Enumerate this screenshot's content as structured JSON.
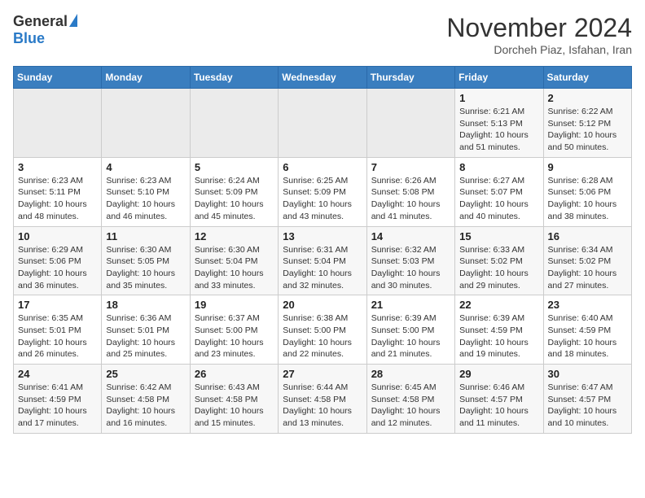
{
  "header": {
    "logo_general": "General",
    "logo_blue": "Blue",
    "month_title": "November 2024",
    "location": "Dorcheh Piaz, Isfahan, Iran"
  },
  "weekdays": [
    "Sunday",
    "Monday",
    "Tuesday",
    "Wednesday",
    "Thursday",
    "Friday",
    "Saturday"
  ],
  "weeks": [
    [
      {
        "day": "",
        "info": ""
      },
      {
        "day": "",
        "info": ""
      },
      {
        "day": "",
        "info": ""
      },
      {
        "day": "",
        "info": ""
      },
      {
        "day": "",
        "info": ""
      },
      {
        "day": "1",
        "info": "Sunrise: 6:21 AM\nSunset: 5:13 PM\nDaylight: 10 hours and 51 minutes."
      },
      {
        "day": "2",
        "info": "Sunrise: 6:22 AM\nSunset: 5:12 PM\nDaylight: 10 hours and 50 minutes."
      }
    ],
    [
      {
        "day": "3",
        "info": "Sunrise: 6:23 AM\nSunset: 5:11 PM\nDaylight: 10 hours and 48 minutes."
      },
      {
        "day": "4",
        "info": "Sunrise: 6:23 AM\nSunset: 5:10 PM\nDaylight: 10 hours and 46 minutes."
      },
      {
        "day": "5",
        "info": "Sunrise: 6:24 AM\nSunset: 5:09 PM\nDaylight: 10 hours and 45 minutes."
      },
      {
        "day": "6",
        "info": "Sunrise: 6:25 AM\nSunset: 5:09 PM\nDaylight: 10 hours and 43 minutes."
      },
      {
        "day": "7",
        "info": "Sunrise: 6:26 AM\nSunset: 5:08 PM\nDaylight: 10 hours and 41 minutes."
      },
      {
        "day": "8",
        "info": "Sunrise: 6:27 AM\nSunset: 5:07 PM\nDaylight: 10 hours and 40 minutes."
      },
      {
        "day": "9",
        "info": "Sunrise: 6:28 AM\nSunset: 5:06 PM\nDaylight: 10 hours and 38 minutes."
      }
    ],
    [
      {
        "day": "10",
        "info": "Sunrise: 6:29 AM\nSunset: 5:06 PM\nDaylight: 10 hours and 36 minutes."
      },
      {
        "day": "11",
        "info": "Sunrise: 6:30 AM\nSunset: 5:05 PM\nDaylight: 10 hours and 35 minutes."
      },
      {
        "day": "12",
        "info": "Sunrise: 6:30 AM\nSunset: 5:04 PM\nDaylight: 10 hours and 33 minutes."
      },
      {
        "day": "13",
        "info": "Sunrise: 6:31 AM\nSunset: 5:04 PM\nDaylight: 10 hours and 32 minutes."
      },
      {
        "day": "14",
        "info": "Sunrise: 6:32 AM\nSunset: 5:03 PM\nDaylight: 10 hours and 30 minutes."
      },
      {
        "day": "15",
        "info": "Sunrise: 6:33 AM\nSunset: 5:02 PM\nDaylight: 10 hours and 29 minutes."
      },
      {
        "day": "16",
        "info": "Sunrise: 6:34 AM\nSunset: 5:02 PM\nDaylight: 10 hours and 27 minutes."
      }
    ],
    [
      {
        "day": "17",
        "info": "Sunrise: 6:35 AM\nSunset: 5:01 PM\nDaylight: 10 hours and 26 minutes."
      },
      {
        "day": "18",
        "info": "Sunrise: 6:36 AM\nSunset: 5:01 PM\nDaylight: 10 hours and 25 minutes."
      },
      {
        "day": "19",
        "info": "Sunrise: 6:37 AM\nSunset: 5:00 PM\nDaylight: 10 hours and 23 minutes."
      },
      {
        "day": "20",
        "info": "Sunrise: 6:38 AM\nSunset: 5:00 PM\nDaylight: 10 hours and 22 minutes."
      },
      {
        "day": "21",
        "info": "Sunrise: 6:39 AM\nSunset: 5:00 PM\nDaylight: 10 hours and 21 minutes."
      },
      {
        "day": "22",
        "info": "Sunrise: 6:39 AM\nSunset: 4:59 PM\nDaylight: 10 hours and 19 minutes."
      },
      {
        "day": "23",
        "info": "Sunrise: 6:40 AM\nSunset: 4:59 PM\nDaylight: 10 hours and 18 minutes."
      }
    ],
    [
      {
        "day": "24",
        "info": "Sunrise: 6:41 AM\nSunset: 4:59 PM\nDaylight: 10 hours and 17 minutes."
      },
      {
        "day": "25",
        "info": "Sunrise: 6:42 AM\nSunset: 4:58 PM\nDaylight: 10 hours and 16 minutes."
      },
      {
        "day": "26",
        "info": "Sunrise: 6:43 AM\nSunset: 4:58 PM\nDaylight: 10 hours and 15 minutes."
      },
      {
        "day": "27",
        "info": "Sunrise: 6:44 AM\nSunset: 4:58 PM\nDaylight: 10 hours and 13 minutes."
      },
      {
        "day": "28",
        "info": "Sunrise: 6:45 AM\nSunset: 4:58 PM\nDaylight: 10 hours and 12 minutes."
      },
      {
        "day": "29",
        "info": "Sunrise: 6:46 AM\nSunset: 4:57 PM\nDaylight: 10 hours and 11 minutes."
      },
      {
        "day": "30",
        "info": "Sunrise: 6:47 AM\nSunset: 4:57 PM\nDaylight: 10 hours and 10 minutes."
      }
    ]
  ]
}
